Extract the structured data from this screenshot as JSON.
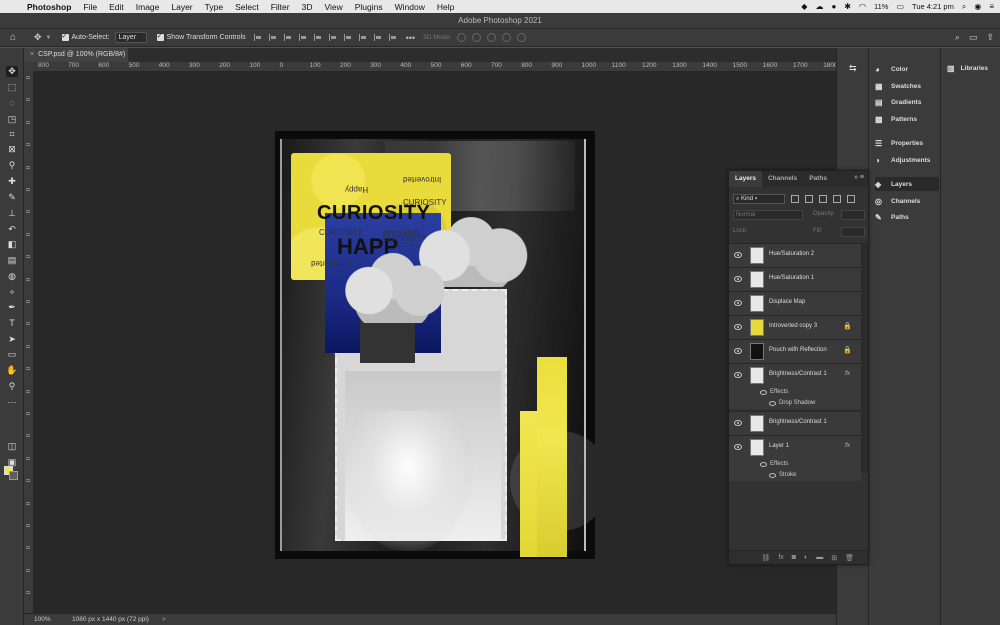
{
  "menubar": {
    "apple": "",
    "app": "Photoshop",
    "items": [
      "File",
      "Edit",
      "Image",
      "Layer",
      "Type",
      "Select",
      "Filter",
      "3D",
      "View",
      "Plugins",
      "Window",
      "Help"
    ],
    "battery": "11%",
    "clock": "Tue 4:21 pm"
  },
  "window": {
    "title": "Adobe Photoshop 2021"
  },
  "options": {
    "auto_select_label": "Auto-Select:",
    "auto_select_value": "Layer",
    "show_transform_label": "Show Transform Controls",
    "mode_3d_label": "3D Mode:"
  },
  "document": {
    "tab_title": "CSP.psd @ 100% (RGB/8#)"
  },
  "ruler": {
    "h_ticks": [
      "800",
      "700",
      "600",
      "500",
      "400",
      "300",
      "200",
      "100",
      "0",
      "100",
      "200",
      "300",
      "400",
      "500",
      "600",
      "700",
      "800",
      "900",
      "1000",
      "1100",
      "1200",
      "1300",
      "1400",
      "1500",
      "1600",
      "1700",
      "1800"
    ],
    "v_ticks": [
      "0",
      "0",
      "0",
      "0",
      "0",
      "0",
      "0",
      "0",
      "0",
      "0",
      "0",
      "0",
      "0",
      "0",
      "0",
      "0",
      "0",
      "0",
      "0",
      "0",
      "0",
      "0",
      "0",
      "0"
    ]
  },
  "artwork": {
    "word_curiosity": "CURIOSITY",
    "word_happ": "HAPP",
    "small_happy": "Happy",
    "small_introverted": "Introverted",
    "small_curiosity": "CURIOSITY",
    "small_introveted": "Introveted"
  },
  "status": {
    "zoom": "100%",
    "info": "1080 px x 1440 px (72 ppi)",
    "arrow": ">"
  },
  "panels": {
    "items": [
      {
        "label": "Color",
        "icon": "color-wheel-icon"
      },
      {
        "label": "Swatches",
        "icon": "swatches-icon"
      },
      {
        "label": "Gradients",
        "icon": "gradients-icon"
      },
      {
        "label": "Patterns",
        "icon": "patterns-icon"
      },
      {
        "label": "Properties",
        "icon": "properties-icon"
      },
      {
        "label": "Adjustments",
        "icon": "adjustments-icon"
      },
      {
        "label": "Layers",
        "icon": "layers-icon"
      },
      {
        "label": "Channels",
        "icon": "channels-icon"
      },
      {
        "label": "Paths",
        "icon": "paths-icon"
      }
    ],
    "libraries": "Libraries"
  },
  "layers_panel": {
    "tabs": [
      "Layers",
      "Channels",
      "Paths"
    ],
    "kind_label": "Kind",
    "blend_mode": "Normal",
    "opacity_label": "Opacity:",
    "lock_label": "Lock:",
    "fill_label": "Fill:",
    "layers": [
      {
        "name": "Hue/Saturation 2",
        "locked": false,
        "fx": false
      },
      {
        "name": "Hue/Saturation 1",
        "locked": false,
        "fx": false
      },
      {
        "name": "Displace Map",
        "locked": false,
        "fx": false
      },
      {
        "name": "Introverted copy 3",
        "locked": true,
        "fx": false
      },
      {
        "name": "Pouch with Reflection",
        "locked": true,
        "fx": false
      },
      {
        "name": "Brightness/Contrast 1",
        "locked": false,
        "fx": true
      },
      {
        "name": "Brightness/Contrast 1",
        "locked": false,
        "fx": false
      },
      {
        "name": "Layer 1",
        "locked": false,
        "fx": true
      }
    ],
    "effects_label": "Effects",
    "drop_shadow_label": "Drop Shadow",
    "stroke_label": "Stroke",
    "fx_symbol": "fx",
    "lock_symbol": "🔒"
  }
}
